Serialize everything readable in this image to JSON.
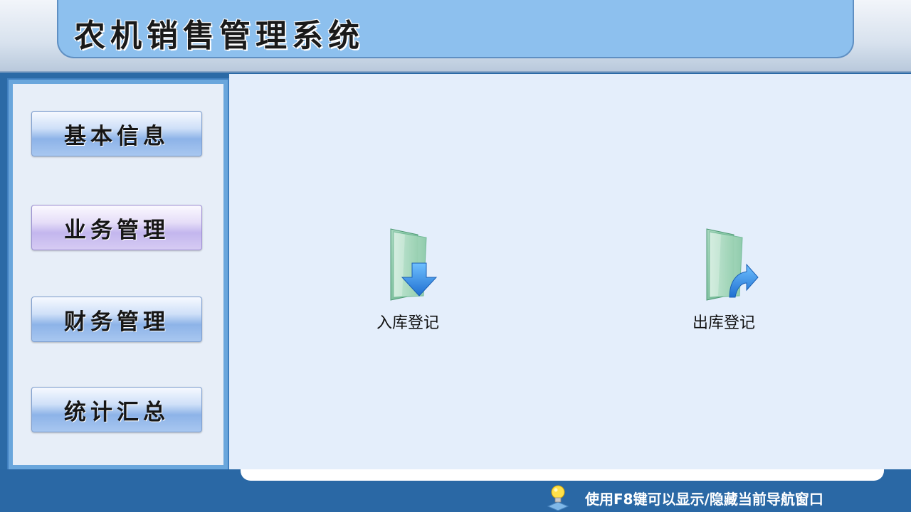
{
  "app": {
    "title": "农机销售管理系统"
  },
  "sidebar": {
    "items": [
      {
        "label": "基本信息",
        "active": false
      },
      {
        "label": "业务管理",
        "active": true
      },
      {
        "label": "财务管理",
        "active": false
      },
      {
        "label": "统计汇总",
        "active": false
      }
    ]
  },
  "main": {
    "functions": [
      {
        "label": "入库登记",
        "icon": "folder-arrow-down-icon"
      },
      {
        "label": "出库登记",
        "icon": "folder-arrow-out-icon"
      }
    ]
  },
  "status_bar": {
    "hint": "使用F8键可以显示/隐藏当前导航窗口",
    "icon": "lightbulb-icon"
  },
  "colors": {
    "banner": "#8dc0ee",
    "background": "#2b6aa6",
    "panel": "#e4eefb",
    "sidebar_border": "#6aa6dc"
  }
}
